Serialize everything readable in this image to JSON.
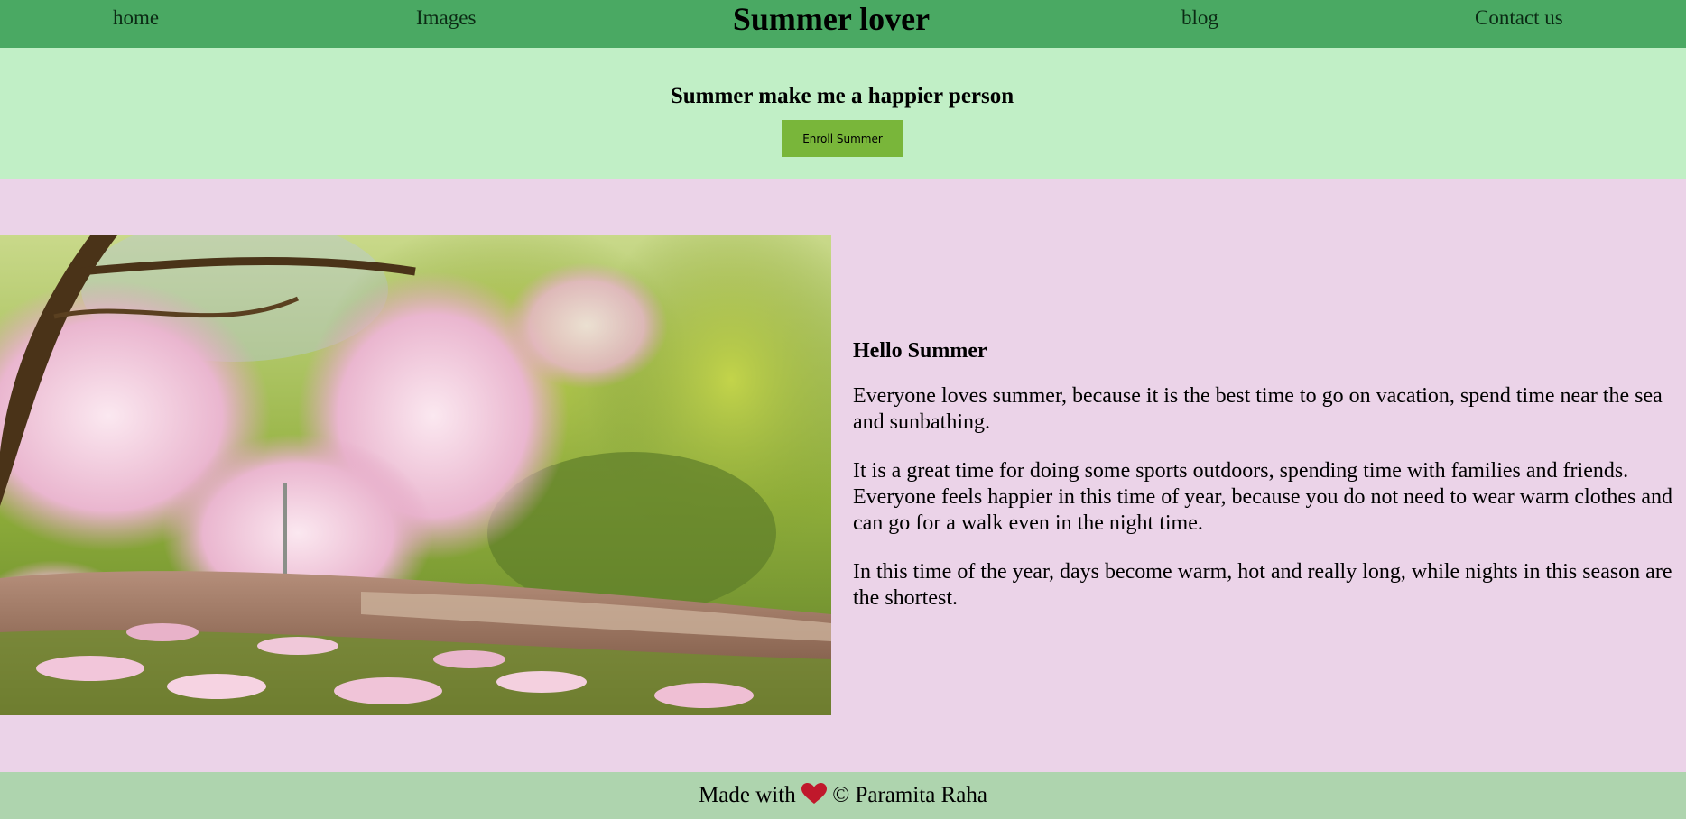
{
  "nav": {
    "home": "home",
    "images": "Images",
    "brand": "Summer lover",
    "blog": "blog",
    "contact": "Contact us"
  },
  "hero": {
    "title": "Summer make me a happier person",
    "button_label": "Enroll Summer"
  },
  "content": {
    "heading": "Hello Summer",
    "paragraphs": [
      "Everyone loves summer, because it is the best time to go on vacation, spend time near the sea and sunbathing.",
      "It is a great time for doing some sports outdoors, spending time with families and friends. Everyone feels happier in this time of year, because you do not need to wear warm clothes and can go for a walk even in the night time.",
      "In this time of the year, days become warm, hot and really long, while nights in this season are the shortest."
    ]
  },
  "footer": {
    "made_with": "Made with",
    "credit": "© Paramita Raha"
  },
  "colors": {
    "nav_bg": "#4aa963",
    "hero_bg": "#c1efc6",
    "button_bg": "#79b63a",
    "main_bg": "#ebd3e8",
    "footer_bg": "#aed4ae",
    "heart": "#c0182b"
  },
  "icons": {
    "heart": "heart-icon",
    "photo": "blossom-garden-photo"
  }
}
